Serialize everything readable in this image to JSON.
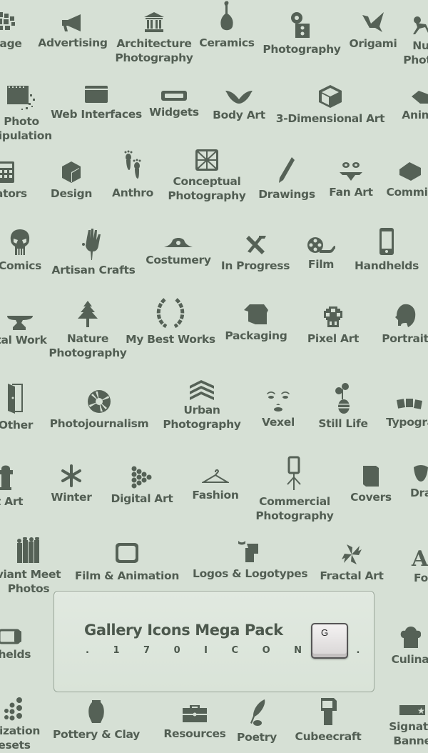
{
  "colors": {
    "background": "#d6e0d5",
    "icon": "#556156",
    "text": "#525e53"
  },
  "categories": [
    {
      "label": "llage",
      "icon": "collage-icon"
    },
    {
      "label": "Advertising",
      "icon": "megaphone-icon"
    },
    {
      "label": "Architecture Photography",
      "line1": "Architecture",
      "line2": "Photography",
      "icon": "building-columns-icon"
    },
    {
      "label": "Ceramics",
      "icon": "vase-icon"
    },
    {
      "label": "Photography",
      "icon": "camera-icon"
    },
    {
      "label": "Origami",
      "icon": "paper-crane-icon"
    },
    {
      "label": "Nu Photo",
      "line1": "Nu",
      "line2": "Photo",
      "icon": "monkey-icon"
    },
    {
      "label": "Photo Manipulation",
      "line1": "Photo",
      "line2": "nipulation",
      "icon": "film-pixels-icon"
    },
    {
      "label": "Web Interfaces",
      "icon": "browser-window-icon"
    },
    {
      "label": "Widgets",
      "icon": "widget-bar-icon"
    },
    {
      "label": "Body Art",
      "icon": "wings-icon"
    },
    {
      "label": "3-Dimensional Art",
      "icon": "cube-wireframe-icon"
    },
    {
      "label": "Anima",
      "icon": "flipbook-icon"
    },
    {
      "label": "ulators",
      "icon": "calculator-icon"
    },
    {
      "label": "Design",
      "icon": "hexagon-cube-icon"
    },
    {
      "label": "Anthro",
      "icon": "footprints-icon"
    },
    {
      "label": "Conceptual Photography",
      "line1": "Conceptual",
      "line2": "Photography",
      "icon": "sunburst-frame-icon"
    },
    {
      "label": "Drawings",
      "icon": "pencil-icon"
    },
    {
      "label": "Fan Art",
      "icon": "bat-mask-icon"
    },
    {
      "label": "Commis",
      "icon": "box-package-icon"
    },
    {
      "label": "Comics",
      "icon": "skull-icon"
    },
    {
      "label": "Artisan Crafts",
      "icon": "hand-print-icon"
    },
    {
      "label": "Costumery",
      "icon": "pirate-hat-icon"
    },
    {
      "label": "In Progress",
      "icon": "tools-icon"
    },
    {
      "label": "Film",
      "icon": "film-reel-icon"
    },
    {
      "label": "Handhelds",
      "icon": "phone-icon"
    },
    {
      "label": "tal Work",
      "icon": "anvil-icon"
    },
    {
      "label": "Nature Photography",
      "line1": "Nature",
      "line2": "Photography",
      "icon": "tree-icon"
    },
    {
      "label": "My Best Works",
      "icon": "laurel-wreath-icon"
    },
    {
      "label": "Packaging",
      "icon": "open-box-icon"
    },
    {
      "label": "Pixel Art",
      "icon": "pixel-mushroom-icon"
    },
    {
      "label": "Portrait",
      "icon": "woman-profile-icon"
    },
    {
      "label": "Other",
      "icon": "door-icon"
    },
    {
      "label": "Photojournalism",
      "icon": "aperture-icon"
    },
    {
      "label": "Urban Photography",
      "line1": "Urban",
      "line2": "Photography",
      "icon": "stacked-roofs-icon"
    },
    {
      "label": "Vexel",
      "icon": "face-icon"
    },
    {
      "label": "Still Life",
      "icon": "flower-vase-icon"
    },
    {
      "label": "Typogra",
      "icon": "abc-blocks-icon"
    },
    {
      "label": "et Art",
      "icon": "hydrant-icon"
    },
    {
      "label": "Winter",
      "icon": "snowflake-icon"
    },
    {
      "label": "Digital Art",
      "icon": "dots-triangle-icon"
    },
    {
      "label": "Fashion",
      "icon": "hanger-icon"
    },
    {
      "label": "Commercial Photography",
      "line1": "Commercial",
      "line2": "Photography",
      "icon": "studio-light-icon"
    },
    {
      "label": "Covers",
      "icon": "book-icon"
    },
    {
      "label": "Dra",
      "icon": "drama-mask-icon"
    },
    {
      "label": "viant Meet Photos",
      "line1": "viant Meet",
      "line2": "Photos",
      "icon": "crowd-icon"
    },
    {
      "label": "Film & Animation",
      "icon": "tv-icon"
    },
    {
      "label": "Logos & Logotypes",
      "icon": "logo-shape-icon"
    },
    {
      "label": "Fractal Art",
      "icon": "pinwheel-icon"
    },
    {
      "label": "Fo",
      "icon": "letter-a-icon"
    },
    {
      "label": "dhelds",
      "icon": "battery-icon"
    },
    {
      "label": "Culina",
      "icon": "chef-hat-icon"
    },
    {
      "label": "alization esets",
      "line1": "alization",
      "line2": "esets",
      "icon": "dots-grid-icon"
    },
    {
      "label": "Pottery & Clay",
      "icon": "urn-icon"
    },
    {
      "label": "Resources",
      "icon": "toolbox-icon"
    },
    {
      "label": "Poetry",
      "icon": "quill-icon"
    },
    {
      "label": "Cubeecraft",
      "icon": "cubee-icon"
    },
    {
      "label": "Signatu Banne",
      "line1": "Signatu",
      "line2": "Banne",
      "icon": "banner-star-icon"
    }
  ],
  "panel": {
    "title": "Gallery Icons Mega Pack",
    "subtitle": ". 1 7 0   I C O N S .",
    "key_label": "G"
  }
}
